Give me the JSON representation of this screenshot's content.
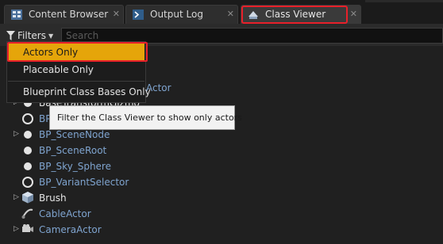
{
  "tabs": [
    {
      "label": "Content Browser",
      "icon": "content-browser-icon",
      "close": "✕"
    },
    {
      "label": "Output Log",
      "icon": "output-log-icon",
      "close": "✕"
    },
    {
      "label": "Class Viewer",
      "icon": "class-viewer-icon",
      "close": "✕"
    }
  ],
  "toolbar": {
    "filters_label": "Filters",
    "search_placeholder": "Search"
  },
  "filter_menu": {
    "items": [
      "Actors Only",
      "Placeable Only",
      "Blueprint Class Bases Only"
    ],
    "selected": "Actors Only"
  },
  "tooltip": "Filter the Class Viewer to show only actors",
  "tree": [
    {
      "label": "Actor",
      "icon": "ring-icon"
    },
    {
      "label": "BaseTransformGizmo",
      "icon": "sphere-icon"
    },
    {
      "label": "BP_",
      "icon": "ring-icon"
    },
    {
      "label": "BP_SceneNode",
      "icon": "sphere-icon"
    },
    {
      "label": "BP_SceneRoot",
      "icon": "sphere-icon"
    },
    {
      "label": "BP_Sky_Sphere",
      "icon": "sphere-icon"
    },
    {
      "label": "BP_VariantSelector",
      "icon": "ring-icon"
    },
    {
      "label": "Brush",
      "icon": "brush-cube-icon"
    },
    {
      "label": "CableActor",
      "icon": "cable-actor-icon"
    },
    {
      "label": "CameraActor",
      "icon": "camera-icon"
    }
  ],
  "colors": {
    "highlight": "#e5a50a",
    "annotation_red": "#e8202a",
    "link_blue": "#7fa4cf"
  }
}
